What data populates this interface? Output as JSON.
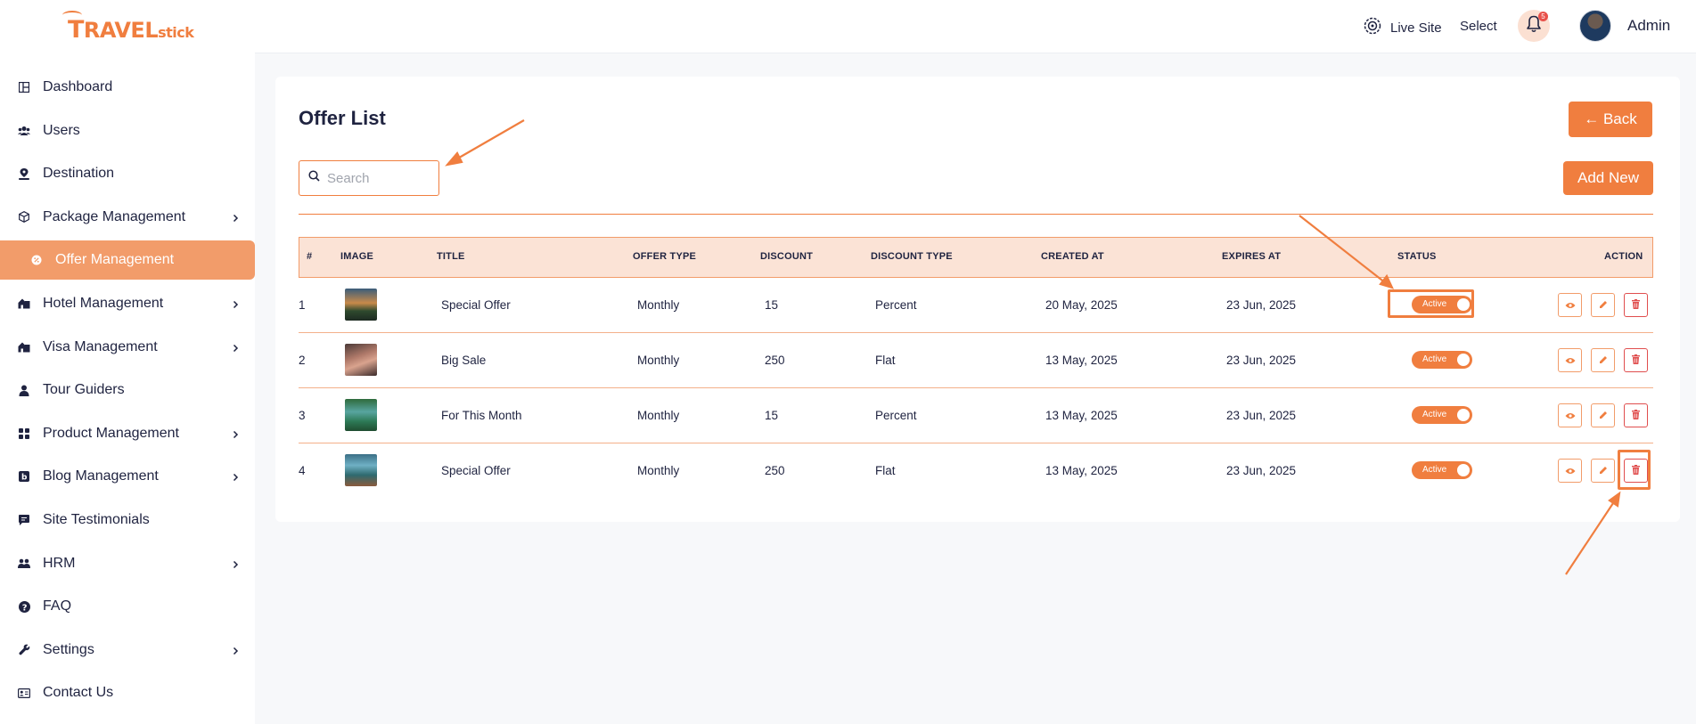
{
  "brand": {
    "logo_big": "T",
    "logo_mid": "RAVEL",
    "logo_small": "stick"
  },
  "sidebar": {
    "items": [
      {
        "label": "Dashboard",
        "icon": "dashboard-icon",
        "submenu": false
      },
      {
        "label": "Users",
        "icon": "users-icon",
        "submenu": false
      },
      {
        "label": "Destination",
        "icon": "location-pin-icon",
        "submenu": false
      },
      {
        "label": "Package Management",
        "icon": "box-icon",
        "submenu": true
      },
      {
        "label": "Offer Management",
        "icon": "offer-icon",
        "submenu": false,
        "active": true
      },
      {
        "label": "Hotel Management",
        "icon": "hotel-icon",
        "submenu": true
      },
      {
        "label": "Visa Management",
        "icon": "visa-icon",
        "submenu": true
      },
      {
        "label": "Tour Guiders",
        "icon": "user-icon",
        "submenu": false
      },
      {
        "label": "Product Management",
        "icon": "grid-icon",
        "submenu": true
      },
      {
        "label": "Blog Management",
        "icon": "blog-icon",
        "submenu": true
      },
      {
        "label": "Site Testimonials",
        "icon": "comment-icon",
        "submenu": false
      },
      {
        "label": "HRM",
        "icon": "team-icon",
        "submenu": true
      },
      {
        "label": "FAQ",
        "icon": "question-icon",
        "submenu": false
      },
      {
        "label": "Settings",
        "icon": "wrench-icon",
        "submenu": true
      },
      {
        "label": "Contact Us",
        "icon": "contact-card-icon",
        "submenu": false
      }
    ]
  },
  "header": {
    "live_site": "Live Site",
    "select": "Select",
    "notification_count": "5",
    "user_name": "Admin"
  },
  "page": {
    "title": "Offer List",
    "back_label": "← Back",
    "add_new_label": "Add New",
    "search_placeholder": "Search"
  },
  "table": {
    "headers": {
      "num": "#",
      "image": "IMAGE",
      "title": "TITLE",
      "offer_type": "OFFER TYPE",
      "discount": "DISCOUNT",
      "discount_type": "DISCOUNT TYPE",
      "created_at": "CREATED AT",
      "expires_at": "EXPIRES AT",
      "status": "STATUS",
      "action": "ACTION"
    },
    "rows": [
      {
        "num": "1",
        "title": "Special Offer",
        "offer_type": "Monthly",
        "discount": "15",
        "discount_type": "Percent",
        "created_at": "20 May, 2025",
        "expires_at": "23 Jun, 2025",
        "status": "Active"
      },
      {
        "num": "2",
        "title": "Big Sale",
        "offer_type": "Monthly",
        "discount": "250",
        "discount_type": "Flat",
        "created_at": "13 May, 2025",
        "expires_at": "23 Jun, 2025",
        "status": "Active"
      },
      {
        "num": "3",
        "title": "For This Month",
        "offer_type": "Monthly",
        "discount": "15",
        "discount_type": "Percent",
        "created_at": "13 May, 2025",
        "expires_at": "23 Jun, 2025",
        "status": "Active"
      },
      {
        "num": "4",
        "title": "Special Offer",
        "offer_type": "Monthly",
        "discount": "250",
        "discount_type": "Flat",
        "created_at": "13 May, 2025",
        "expires_at": "23 Jun, 2025",
        "status": "Active"
      }
    ]
  },
  "colors": {
    "accent": "#f07e3f",
    "accent_light": "#fbe3d6",
    "danger": "#e04e4e",
    "text": "#1f2340"
  }
}
